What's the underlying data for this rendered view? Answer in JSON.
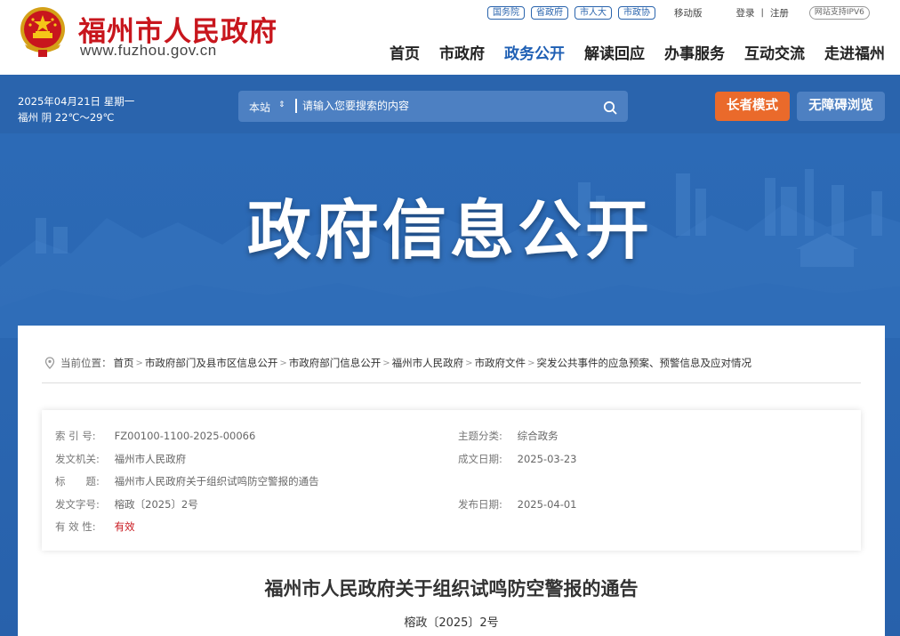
{
  "header": {
    "site_name": "福州市人民政府",
    "site_url": "www.fuzhou.gov.cn",
    "top_pills": [
      "国务院",
      "省政府",
      "市人大",
      "市政协"
    ],
    "mobile": "移动版",
    "login": "登录",
    "separator": "|",
    "register": "注册",
    "ipv6": "网站支持IPV6",
    "nav": [
      "首页",
      "市政府",
      "政务公开",
      "解读回应",
      "办事服务",
      "互动交流",
      "走进福州"
    ],
    "active_nav": "政务公开"
  },
  "bar": {
    "date": "2025年04月21日 星期一",
    "weather": "福州 阴 22℃～29℃",
    "scope": "本站",
    "scope_arrow": "⇕",
    "search_placeholder": "请输入您要搜索的内容",
    "elder_mode": "长者模式",
    "accessible": "无障碍浏览"
  },
  "banner": {
    "title": "政府信息公开"
  },
  "breadcrumb": {
    "label": "当前位置：",
    "items": [
      "首页",
      "市政府部门及县市区信息公开",
      "市政府部门信息公开",
      "福州市人民政府",
      "市政府文件",
      "突发公共事件的应急预案、预警信息及应对情况"
    ],
    "separator": ">"
  },
  "meta": {
    "index_label": "索 引 号:",
    "index_value": "FZ00100-1100-2025-00066",
    "topic_label": "主题分类:",
    "topic_value": "综合政务",
    "issuer_label": "发文机关:",
    "issuer_value": "福州市人民政府",
    "date_made_label": "成文日期:",
    "date_made_value": "2025-03-23",
    "title_label": "标　　题:",
    "title_value": "福州市人民政府关于组织试鸣防空警报的通告",
    "docno_label": "发文字号:",
    "docno_value": "榕政〔2025〕2号",
    "pub_label": "发布日期:",
    "pub_value": "2025-04-01",
    "valid_label": "有 效 性:",
    "valid_value": "有效"
  },
  "document": {
    "title": "福州市人民政府关于组织试鸣防空警报的通告",
    "number": "榕政〔2025〕2号"
  },
  "colors": {
    "brand_red": "#c8161d",
    "primary_blue": "#2a64ad",
    "nav_active": "#1e5fb4",
    "elder_orange": "#ea6a2b"
  },
  "icons": [
    "national-emblem-icon",
    "search-icon",
    "location-pin-icon"
  ]
}
